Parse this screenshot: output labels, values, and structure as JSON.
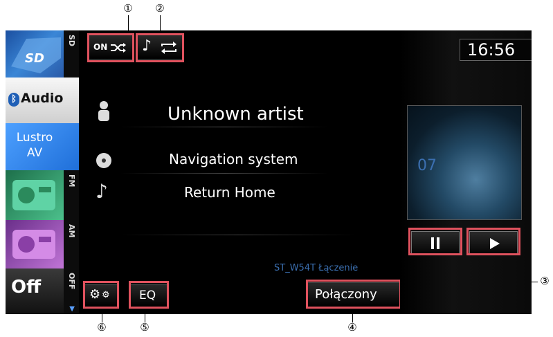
{
  "callouts": {
    "c1": "①",
    "c2": "②",
    "c3": "③",
    "c4": "④",
    "c5": "⑤",
    "c6": "⑥"
  },
  "sidebar": {
    "items": [
      {
        "label": "SD"
      },
      {
        "label": "Audio"
      },
      {
        "label": "Lustro AV"
      },
      {
        "label": "FM"
      },
      {
        "label": "AM"
      },
      {
        "label": "Off",
        "side": "OFF"
      }
    ]
  },
  "topbar": {
    "random_label": "ON",
    "clock": "16:56"
  },
  "track": {
    "artist": "Unknown artist",
    "album": "Navigation system",
    "title": "Return Home",
    "number": "07"
  },
  "status": {
    "device": "ST_W54T Łączenie",
    "connection": "Połączony"
  },
  "buttons": {
    "eq": "EQ"
  },
  "colors": {
    "highlight": "#e0525e",
    "accent_blue": "#3b6fb0"
  }
}
